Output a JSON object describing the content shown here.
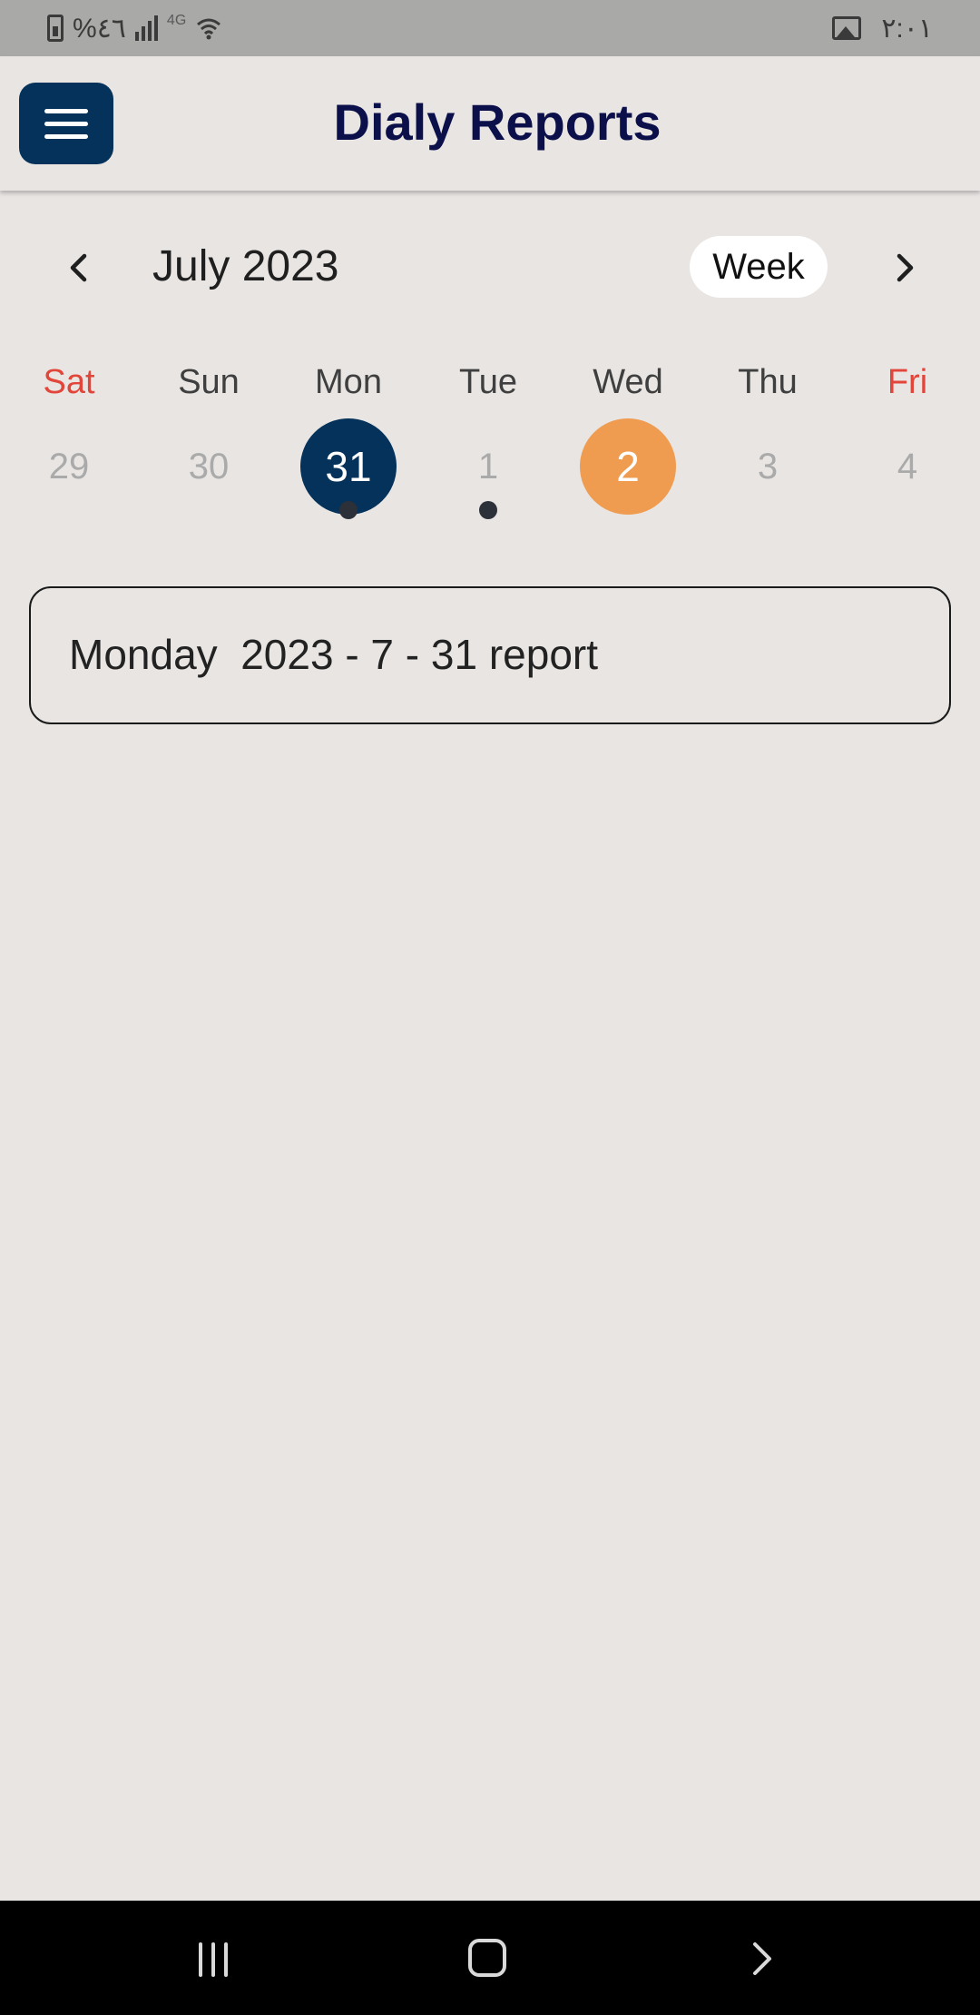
{
  "status_bar": {
    "battery_text": "%٤٦",
    "network_label": "4G",
    "time": "٢:٠١"
  },
  "header": {
    "title": "Dialy Reports",
    "menu_icon": "hamburger-menu-icon"
  },
  "calendar": {
    "month_label": "July 2023",
    "view_toggle": "Week",
    "prev_icon": "chevron-left-icon",
    "next_icon": "chevron-right-icon",
    "weekdays": [
      {
        "label": "Sat",
        "weekend": true
      },
      {
        "label": "Sun",
        "weekend": false
      },
      {
        "label": "Mon",
        "weekend": false
      },
      {
        "label": "Tue",
        "weekend": false
      },
      {
        "label": "Wed",
        "weekend": false
      },
      {
        "label": "Thu",
        "weekend": false
      },
      {
        "label": "Fri",
        "weekend": true
      }
    ],
    "dates": [
      {
        "label": "29",
        "state": "muted",
        "has_event": false
      },
      {
        "label": "30",
        "state": "muted",
        "has_event": false
      },
      {
        "label": "31",
        "state": "selected",
        "has_event": true
      },
      {
        "label": "1",
        "state": "muted",
        "has_event": true
      },
      {
        "label": "2",
        "state": "today",
        "has_event": false
      },
      {
        "label": "3",
        "state": "muted",
        "has_event": false
      },
      {
        "label": "4",
        "state": "muted",
        "has_event": false
      }
    ],
    "colors": {
      "selected": "#04325a",
      "today": "#ef9c50",
      "weekend": "#e2453a"
    }
  },
  "report": {
    "label": "Monday  2023 - 7 - 31 report"
  },
  "nav_bar": {
    "recents_icon": "recents-icon",
    "home_icon": "home-icon",
    "back_icon": "back-icon"
  }
}
